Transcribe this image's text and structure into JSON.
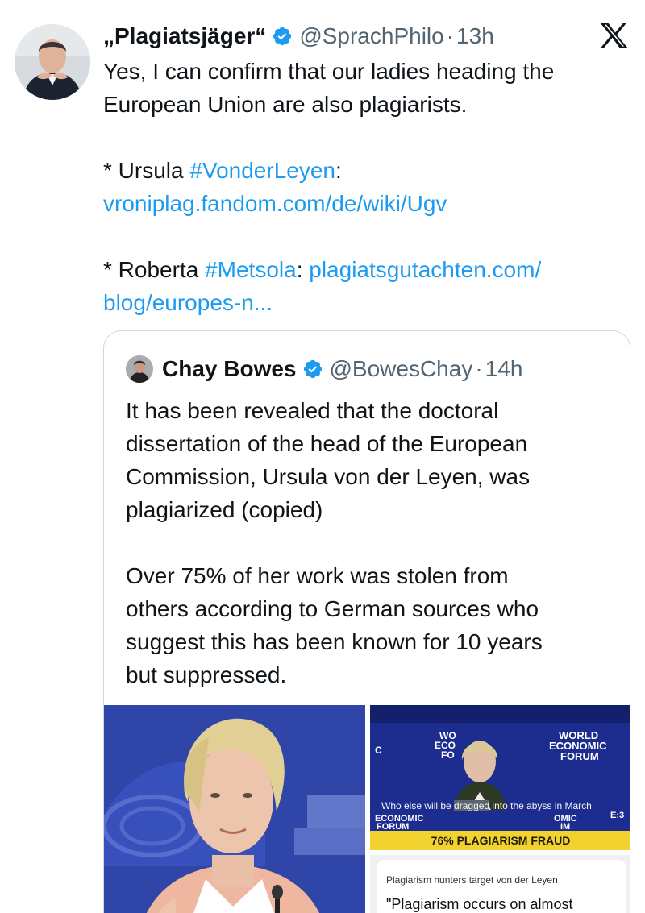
{
  "tweet": {
    "display_name": "„Plagiatsjäger“",
    "handle": "@SprachPhilo",
    "time": "13h",
    "separator": "·",
    "platform_icon": "x-logo-icon",
    "verified_icon": "verified-badge-icon",
    "lines": {
      "l1": "Yes, I can confirm that our ladies heading the",
      "l2": "European Union are also plagiarists.",
      "l3_prefix": "* Ursula ",
      "l3_tag": "#VonderLeyen",
      "l3_suffix": ":",
      "l4_link": "vroniplag.fandom.com/de/wiki/Ugv",
      "l5_prefix": "* Roberta ",
      "l5_tag": "#Metsola",
      "l5_mid": ": ",
      "l5_link": "plagiatsgutachten.com/",
      "l6_link": "blog/europes-n..."
    }
  },
  "quote": {
    "display_name": "Chay Bowes",
    "handle": "@BowesChay",
    "time": "14h",
    "separator": "·",
    "lines": {
      "l1": "It has been revealed that the doctoral",
      "l2": "dissertation of the head of the European",
      "l3": "Commission, Ursula von der Leyen, was",
      "l4": "plagiarized (copied)",
      "l5": "Over 75% of her work was stolen from",
      "l6": "others according to German sources who",
      "l7": "suggest this has been known for 10 years",
      "l8": "but suppressed."
    },
    "media": {
      "wef_caption_pre": "Who else will be ",
      "wef_caption_hl": "dragged",
      "wef_caption_post": " into the abyss in March",
      "wef_banner": "76% PLAGIARISM FRAUD",
      "card_kicker": "Plagiarism hunters target von der Leyen",
      "card_headline": "\"Plagiarism occurs on almost"
    }
  },
  "colors": {
    "link": "#1d9bf0",
    "muted": "#536471",
    "verified": "#1d9bf0",
    "banner": "#f2d22e",
    "border": "#cfd9de"
  }
}
